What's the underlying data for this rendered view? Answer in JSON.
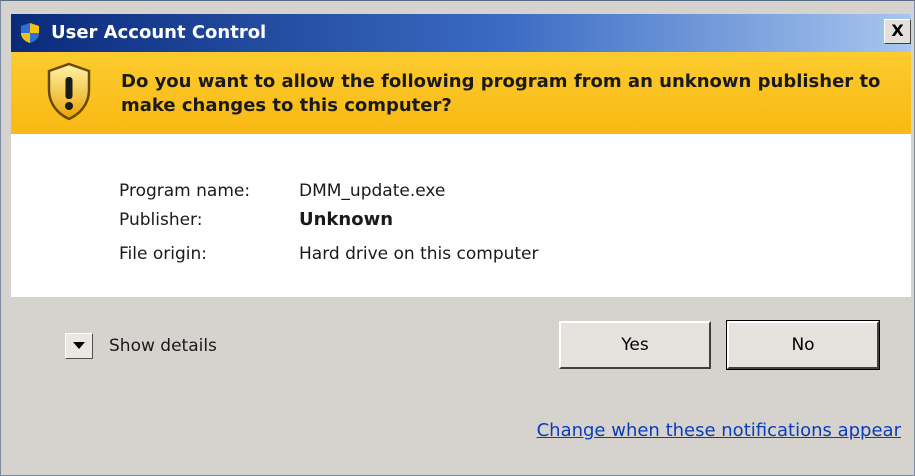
{
  "window": {
    "title": "User Account Control",
    "close_glyph": "X"
  },
  "banner": {
    "question": "Do you want to allow the following program from an unknown publisher to make changes to this computer?",
    "icon": "warning-shield-icon"
  },
  "info": {
    "program_name_label": "Program name:",
    "program_name_value": "DMM_update.exe",
    "publisher_label": "Publisher:",
    "publisher_value": "Unknown",
    "file_origin_label": "File origin:",
    "file_origin_value": "Hard drive on this computer"
  },
  "footer": {
    "show_details_label": "Show details",
    "yes_label": "Yes",
    "no_label": "No",
    "settings_link": "Change when these notifications appear"
  },
  "colors": {
    "titlebar_dark": "#0a2a7a",
    "banner_yellow": "#f8b914",
    "dialog_gray": "#d6d3ce",
    "link_blue": "#0a3cb8"
  }
}
